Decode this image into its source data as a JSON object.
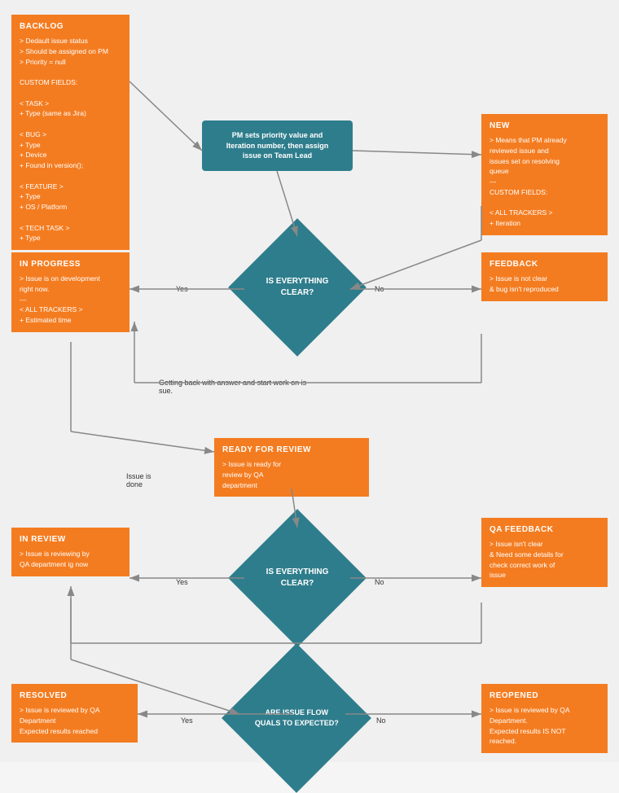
{
  "boxes": {
    "backlog": {
      "title": "BACKLOG",
      "lines": [
        "> Dedault issue status",
        "> Should be assigned on PM",
        "> Priority = null",
        "",
        "CUSTOM FIELDS:",
        "",
        "< TASK >",
        "+ Type (same as Jira)",
        "",
        "< BUG >",
        "+ Type",
        "+ Device",
        "+ Found in version();",
        "",
        "< FEATURE >",
        "+ Type",
        "+ OS / Platform",
        "",
        "< TECH TASK >",
        "+ Type"
      ]
    },
    "new": {
      "title": "NEW",
      "lines": [
        "> Means that PM already",
        "reviewed issue and",
        "issues set on resolving",
        "queue",
        "---",
        "CUSTOM FIELDS:",
        "",
        "< ALL TRACKERS >",
        "+ Iteration"
      ]
    },
    "inprogress": {
      "title": "IN PROGRESS",
      "lines": [
        "> Issue is on development",
        "right now.",
        "---",
        "< ALL TRACKERS >",
        "+ Estimated time"
      ]
    },
    "feedback": {
      "title": "FEEDBACK",
      "lines": [
        "> Issue is not clear",
        "& bug isn't reproduced"
      ]
    },
    "readyforreview": {
      "title": "READY FOR REVIEW",
      "lines": [
        "> Issue is ready for",
        "review by QA",
        "department"
      ]
    },
    "inreview": {
      "title": "IN REVIEW",
      "lines": [
        "> Issue is reviewing by",
        "QA department ig now"
      ]
    },
    "qafeedback": {
      "title": "QA FEEDBACK",
      "lines": [
        "> Issue isn't clear",
        "& Need some details for",
        "check correct work of",
        "issue"
      ]
    },
    "resolved": {
      "title": "RESOLVED",
      "lines": [
        "> Issue is reviewed by QA",
        "Department",
        "Expected results reached"
      ]
    },
    "reopened": {
      "title": "REOPENED",
      "lines": [
        "> Issue is reviewed by QA",
        "Department.",
        "Expected results IS NOT",
        "reached."
      ]
    },
    "pmprocess": {
      "text": "PM sets priority value and\nIteration number, then assign\nissue on Team Lead"
    },
    "diamond1": {
      "text": "IS EVERYTHING\nCLEAR?"
    },
    "diamond2": {
      "text": "IS EVERYTHING\nCLEAR?"
    },
    "diamond3": {
      "text": "ARE ISSUE FLOW\nQUALS TO EXPECTED?"
    }
  },
  "labels": {
    "yes1": "Yes",
    "no1": "No",
    "yes2": "Yes",
    "no2": "No",
    "yes3": "Yes",
    "no3": "No",
    "gettingback": "Getting back with answer and start work on is\nsue.",
    "issuedone": "Issue is\ndone"
  },
  "colors": {
    "orange": "#F47C20",
    "teal": "#2E7D8C",
    "arrow": "#888888",
    "bg": "#f0f0f0"
  }
}
